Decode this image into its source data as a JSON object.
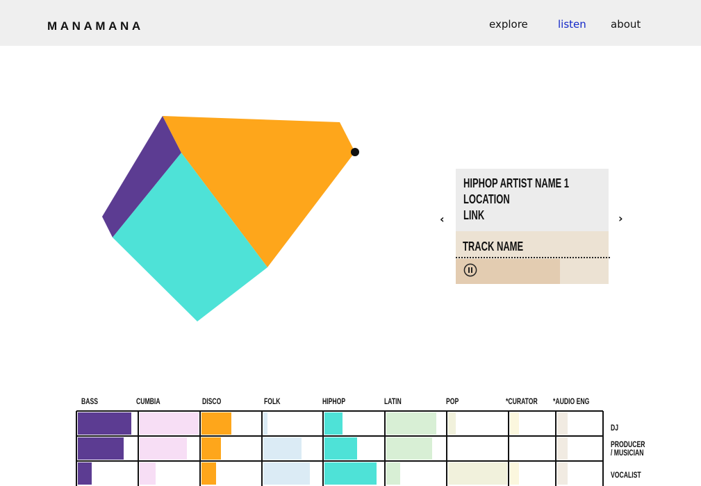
{
  "header": {
    "logo": "MANAMANA",
    "nav": [
      {
        "label": "explore",
        "active": false
      },
      {
        "label": "listen",
        "active": true
      },
      {
        "label": "about",
        "active": false
      }
    ],
    "active_color": "#1428c8"
  },
  "visual": {
    "colors": {
      "orange": "#fea61b",
      "teal": "#4ee2d7",
      "purple": "#5c3c92",
      "marker": "#111111"
    }
  },
  "artist_card": {
    "artist_name": "HIPHOP ARTIST NAME 1",
    "location": "LOCATION",
    "link": "LINK",
    "track_name": "TRACK NAME",
    "prev_icon": "chevron-left-icon",
    "next_icon": "chevron-right-icon",
    "pause_icon": "pause-icon",
    "playback_progress": 0.68
  },
  "grid": {
    "genres": [
      "BASS",
      "CUMBIA",
      "DISCO",
      "FOLK",
      "HIPHOP",
      "LATIN",
      "POP",
      "*CURATOR",
      "*AUDIO ENG"
    ],
    "roles": [
      {
        "label": "DJ"
      },
      {
        "label": "PRODUCER / MUSICIAN"
      },
      {
        "label": "VOCALIST"
      }
    ],
    "genre_colors": [
      "#5c3c92",
      "#f7def5",
      "#fea61b",
      "#dbebf5",
      "#4ee2d7",
      "#d8efd5",
      "#f1f1dc",
      "#fbf7de",
      "#f1ebe2"
    ],
    "fill_levels": [
      [
        0.9,
        1.0,
        0.5,
        0.07,
        0.3,
        0.85,
        0.13,
        0.2,
        0.23
      ],
      [
        0.78,
        0.8,
        0.33,
        0.65,
        0.55,
        0.78,
        0.0,
        0.0,
        0.23
      ],
      [
        0.23,
        0.27,
        0.25,
        0.8,
        0.88,
        0.23,
        1.0,
        0.2,
        0.23
      ]
    ]
  }
}
